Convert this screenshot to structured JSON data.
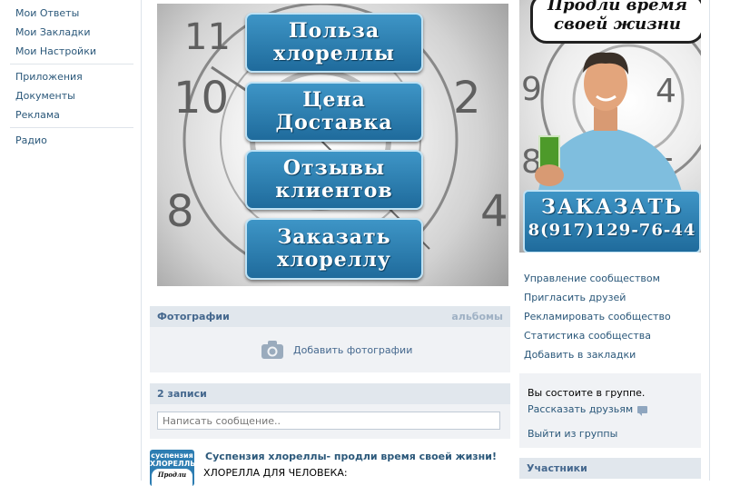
{
  "left_nav": {
    "items": [
      "Мои Ответы",
      "Мои Закладки",
      "Мои Настройки"
    ],
    "items2": [
      "Приложения",
      "Документы",
      "Реклама"
    ],
    "items3": [
      "Радио"
    ]
  },
  "menu_graphic": {
    "buttons": [
      {
        "line1": "Польза",
        "line2": "хлореллы"
      },
      {
        "line1": "Цена",
        "line2": "Доставка"
      },
      {
        "line1": "Отзывы",
        "line2": "клиентов"
      },
      {
        "line1": "Заказать",
        "line2": "хлореллу"
      }
    ]
  },
  "avatar": {
    "slogan_line1": "Продли время",
    "slogan_line2": "своей жизни",
    "order_label": "ЗАКАЗАТЬ",
    "phone": "8(917)129-76-44"
  },
  "actions": [
    "Управление сообществом",
    "Пригласить друзей",
    "Рекламировать сообщество",
    "Статистика сообщества",
    "Добавить в закладки"
  ],
  "photos": {
    "title": "Фотографии",
    "albums_link": "альбомы",
    "add_label": "Добавить фотографии"
  },
  "wall": {
    "count_label": "2 записи",
    "input_placeholder": "Написать сообщение..",
    "post_thumb_line1": "суспензия",
    "post_thumb_line2": "ХЛОРЕЛЛЫ",
    "post_thumb_line3": "Продли время",
    "post_title": "Суспензия хлореллы- продли время своей жизни!",
    "post_text": "ХЛОРЕЛЛА ДЛЯ ЧЕЛОВЕКА:"
  },
  "membership": {
    "status": "Вы состоите в группе.",
    "share_label": "Рассказать друзьям",
    "leave_label": "Выйти из группы"
  },
  "members": {
    "title": "Участники"
  }
}
